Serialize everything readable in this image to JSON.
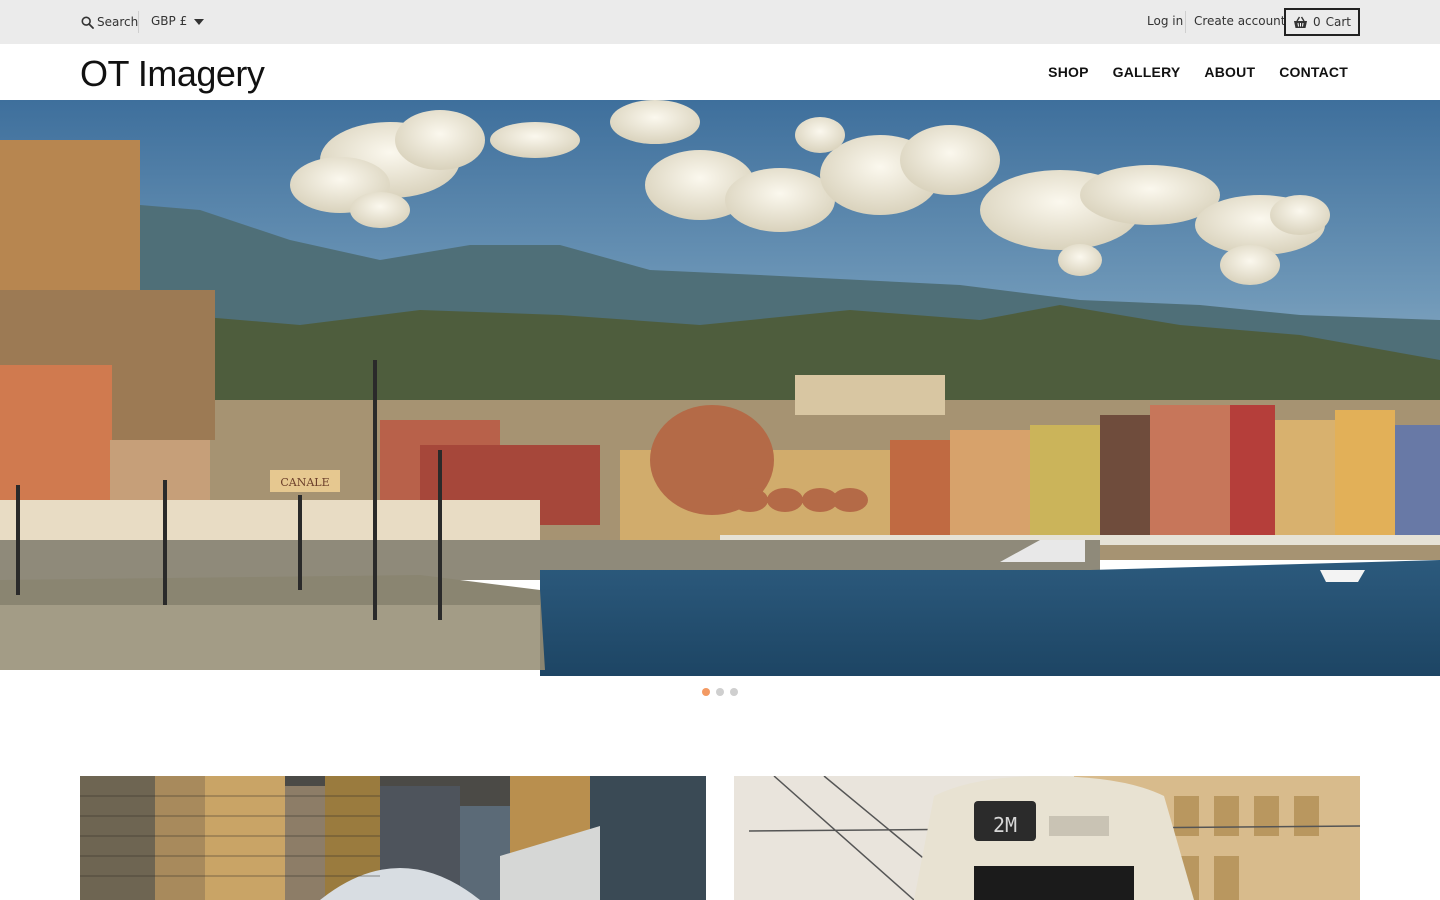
{
  "topbar": {
    "search_label": "Search",
    "currency": "GBP £",
    "login_label": "Log in",
    "create_account_label": "Create account",
    "cart_count": "0",
    "cart_label": "Cart"
  },
  "header": {
    "logo": "OT Imagery",
    "nav": [
      {
        "label": "SHOP"
      },
      {
        "label": "GALLERY"
      },
      {
        "label": "ABOUT"
      },
      {
        "label": "CONTACT"
      }
    ]
  },
  "hero": {
    "sign_text": "CANALE",
    "slide_count": 3,
    "active_slide": 1
  },
  "colors": {
    "topbar_bg": "#ebebeb",
    "active_dot": "#f39a63",
    "inactive_dot": "#cfcfcf"
  },
  "cards": [
    {
      "subject": "city skyline with towers"
    },
    {
      "subject": "tram in front of building",
      "tram_display": "2M"
    }
  ]
}
